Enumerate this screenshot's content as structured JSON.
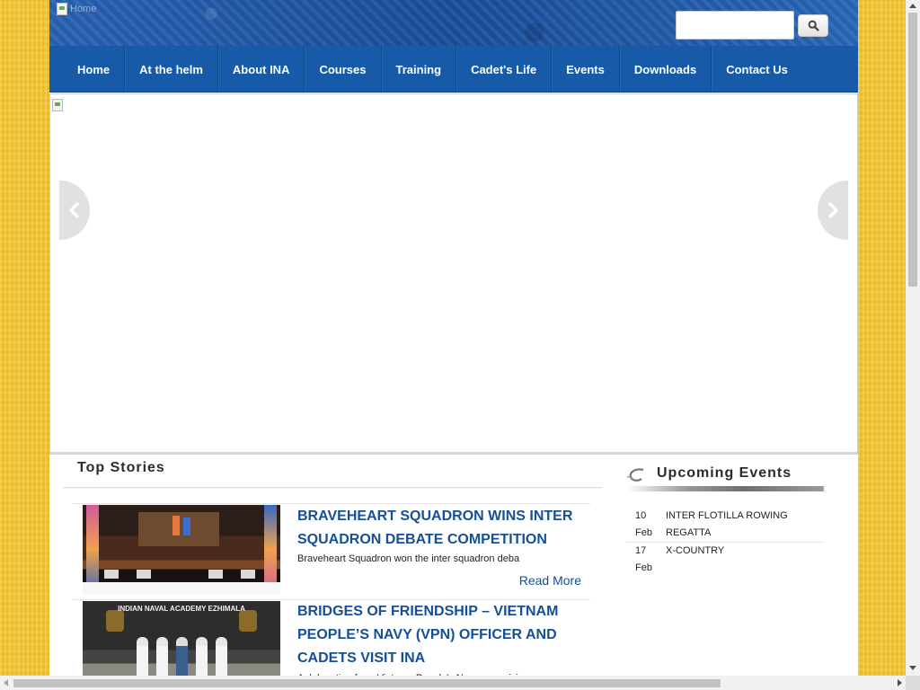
{
  "header": {
    "logo_alt": "Home",
    "search": {
      "placeholder": "",
      "value": ""
    }
  },
  "nav": {
    "items": [
      "Home",
      "At the helm",
      "About INA",
      "Courses",
      "Training",
      "Cadet's Life",
      "Events",
      "Downloads",
      "Contact Us"
    ]
  },
  "top_stories": {
    "title": "Top Stories",
    "items": [
      {
        "title": "BRAVEHEART SQUADRON WINS INTER SQUADRON DEBATE COMPETITION",
        "excerpt": "Braveheart Squadron won the inter squadron deba",
        "read_more": "Read More"
      },
      {
        "title": "BRIDGES OF FRIENDSHIP – VIETNAM PEOPLE’S NAVY (VPN) OFFICER AND CADETS VISIT INA",
        "excerpt": "A delegation from Vietnam People's Navy comprising",
        "thumb_sign": "INDIAN NAVAL ACADEMY EZHIMALA"
      }
    ]
  },
  "upcoming_events": {
    "title": "Upcoming Events",
    "items": [
      {
        "day": "10",
        "month": "Feb",
        "name": "INTER FLOTILLA ROWING REGATTA"
      },
      {
        "day": "17",
        "month": "Feb",
        "name": "X-COUNTRY"
      }
    ]
  }
}
